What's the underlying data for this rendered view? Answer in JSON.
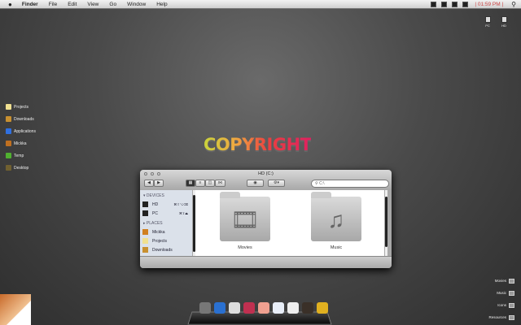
{
  "menubar": {
    "app": "Finder",
    "items": [
      "File",
      "Edit",
      "View",
      "Go",
      "Window",
      "Help"
    ],
    "clock": "| 01:59 PM |"
  },
  "desktop_drives": [
    "PC",
    "HD"
  ],
  "left_shortcuts": [
    {
      "label": "Projects",
      "color": "#f0e090"
    },
    {
      "label": "Downloads",
      "color": "#c89030"
    },
    {
      "label": "Applications",
      "color": "#3070e0"
    },
    {
      "label": "Mickka",
      "color": "#c07020"
    },
    {
      "label": "Temp",
      "color": "#50b030"
    },
    {
      "label": "Desktop",
      "color": "#706030"
    }
  ],
  "wallpaper_text": "COPYRIGHT",
  "finder": {
    "title": "HD (C:)",
    "search_value": "C:\\",
    "sidebar": {
      "devices_header": "DEVICES",
      "devices": [
        {
          "label": "HD",
          "shortcut": "⌘⇧⌥⌫"
        },
        {
          "label": "PC",
          "shortcut": "⌘⇧⏏"
        }
      ],
      "places_header": "PLACES",
      "places": [
        "Mickka",
        "Projects",
        "Downloads"
      ]
    },
    "items": [
      "Movies",
      "Music"
    ]
  },
  "right_shortcuts": [
    "Movies",
    "Music",
    "Icons",
    "Resources"
  ],
  "dock": [
    "skull",
    "feather",
    "dvd-player",
    "cereal-box",
    "piggy-bank",
    "milk",
    "robot",
    "photoshop",
    "box"
  ]
}
